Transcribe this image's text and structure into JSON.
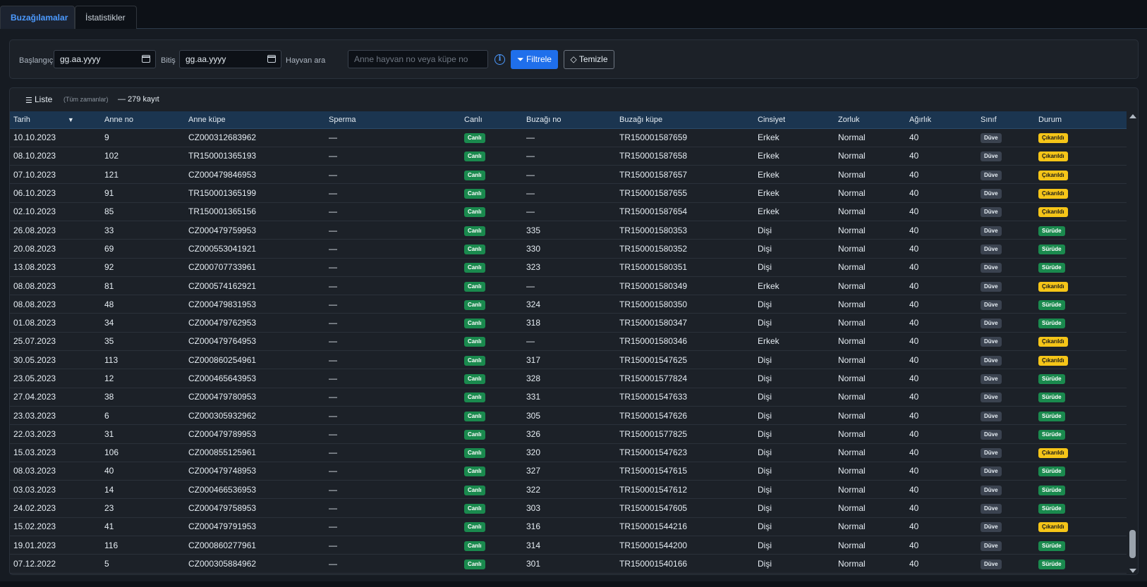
{
  "tabs": [
    {
      "label": "Buzağılamalar",
      "active": true
    },
    {
      "label": "İstatistikler",
      "active": false
    }
  ],
  "filter": {
    "start_label": "Başlangıç",
    "start_value": "gg.aa.yyyy",
    "end_label": "Bitiş",
    "end_value": "gg.aa.yyyy",
    "search_label": "Hayvan ara",
    "search_placeholder": "Anne hayvan no veya küpe no",
    "info_icon": "i",
    "filter_button": "Filtrele",
    "clear_button": "Temizle"
  },
  "list": {
    "icon": "☰",
    "title": "Liste",
    "period": "(Tüm zamanlar)",
    "count": "— 279 kayıt"
  },
  "columns": [
    "Tarih",
    "Anne no",
    "Anne küpe",
    "Sperma",
    "Canlı",
    "Buzağı no",
    "Buzağı küpe",
    "Cinsiyet",
    "Zorluk",
    "Ağırlık",
    "Sınıf",
    "Durum"
  ],
  "sort_indicator": "▼",
  "rows": [
    {
      "tarih": "10.10.2023",
      "anne_no": "9",
      "anne_kupe": "CZ000312683962",
      "sperma": "—",
      "canli": "Canlı",
      "buzagi_no": "—",
      "buzagi_kupe": "TR150001587659",
      "cinsiyet": "Erkek",
      "zorluk": "Normal",
      "agirlik": "40",
      "sinif": "Düve",
      "durum": "Çıkarıldı"
    },
    {
      "tarih": "08.10.2023",
      "anne_no": "102",
      "anne_kupe": "TR150001365193",
      "sperma": "—",
      "canli": "Canlı",
      "buzagi_no": "—",
      "buzagi_kupe": "TR150001587658",
      "cinsiyet": "Erkek",
      "zorluk": "Normal",
      "agirlik": "40",
      "sinif": "Düve",
      "durum": "Çıkarıldı"
    },
    {
      "tarih": "07.10.2023",
      "anne_no": "121",
      "anne_kupe": "CZ000479846953",
      "sperma": "—",
      "canli": "Canlı",
      "buzagi_no": "—",
      "buzagi_kupe": "TR150001587657",
      "cinsiyet": "Erkek",
      "zorluk": "Normal",
      "agirlik": "40",
      "sinif": "Düve",
      "durum": "Çıkarıldı"
    },
    {
      "tarih": "06.10.2023",
      "anne_no": "91",
      "anne_kupe": "TR150001365199",
      "sperma": "—",
      "canli": "Canlı",
      "buzagi_no": "—",
      "buzagi_kupe": "TR150001587655",
      "cinsiyet": "Erkek",
      "zorluk": "Normal",
      "agirlik": "40",
      "sinif": "Düve",
      "durum": "Çıkarıldı"
    },
    {
      "tarih": "02.10.2023",
      "anne_no": "85",
      "anne_kupe": "TR150001365156",
      "sperma": "—",
      "canli": "Canlı",
      "buzagi_no": "—",
      "buzagi_kupe": "TR150001587654",
      "cinsiyet": "Erkek",
      "zorluk": "Normal",
      "agirlik": "40",
      "sinif": "Düve",
      "durum": "Çıkarıldı"
    },
    {
      "tarih": "26.08.2023",
      "anne_no": "33",
      "anne_kupe": "CZ000479759953",
      "sperma": "—",
      "canli": "Canlı",
      "buzagi_no": "335",
      "buzagi_kupe": "TR150001580353",
      "cinsiyet": "Dişi",
      "zorluk": "Normal",
      "agirlik": "40",
      "sinif": "Düve",
      "durum": "Sürüde"
    },
    {
      "tarih": "20.08.2023",
      "anne_no": "69",
      "anne_kupe": "CZ000553041921",
      "sperma": "—",
      "canli": "Canlı",
      "buzagi_no": "330",
      "buzagi_kupe": "TR150001580352",
      "cinsiyet": "Dişi",
      "zorluk": "Normal",
      "agirlik": "40",
      "sinif": "Düve",
      "durum": "Sürüde"
    },
    {
      "tarih": "13.08.2023",
      "anne_no": "92",
      "anne_kupe": "CZ000707733961",
      "sperma": "—",
      "canli": "Canlı",
      "buzagi_no": "323",
      "buzagi_kupe": "TR150001580351",
      "cinsiyet": "Dişi",
      "zorluk": "Normal",
      "agirlik": "40",
      "sinif": "Düve",
      "durum": "Sürüde"
    },
    {
      "tarih": "08.08.2023",
      "anne_no": "81",
      "anne_kupe": "CZ000574162921",
      "sperma": "—",
      "canli": "Canlı",
      "buzagi_no": "—",
      "buzagi_kupe": "TR150001580349",
      "cinsiyet": "Erkek",
      "zorluk": "Normal",
      "agirlik": "40",
      "sinif": "Düve",
      "durum": "Çıkarıldı"
    },
    {
      "tarih": "08.08.2023",
      "anne_no": "48",
      "anne_kupe": "CZ000479831953",
      "sperma": "—",
      "canli": "Canlı",
      "buzagi_no": "324",
      "buzagi_kupe": "TR150001580350",
      "cinsiyet": "Dişi",
      "zorluk": "Normal",
      "agirlik": "40",
      "sinif": "Düve",
      "durum": "Sürüde"
    },
    {
      "tarih": "01.08.2023",
      "anne_no": "34",
      "anne_kupe": "CZ000479762953",
      "sperma": "—",
      "canli": "Canlı",
      "buzagi_no": "318",
      "buzagi_kupe": "TR150001580347",
      "cinsiyet": "Dişi",
      "zorluk": "Normal",
      "agirlik": "40",
      "sinif": "Düve",
      "durum": "Sürüde"
    },
    {
      "tarih": "25.07.2023",
      "anne_no": "35",
      "anne_kupe": "CZ000479764953",
      "sperma": "—",
      "canli": "Canlı",
      "buzagi_no": "—",
      "buzagi_kupe": "TR150001580346",
      "cinsiyet": "Erkek",
      "zorluk": "Normal",
      "agirlik": "40",
      "sinif": "Düve",
      "durum": "Çıkarıldı"
    },
    {
      "tarih": "30.05.2023",
      "anne_no": "113",
      "anne_kupe": "CZ000860254961",
      "sperma": "—",
      "canli": "Canlı",
      "buzagi_no": "317",
      "buzagi_kupe": "TR150001547625",
      "cinsiyet": "Dişi",
      "zorluk": "Normal",
      "agirlik": "40",
      "sinif": "Düve",
      "durum": "Çıkarıldı"
    },
    {
      "tarih": "23.05.2023",
      "anne_no": "12",
      "anne_kupe": "CZ000465643953",
      "sperma": "—",
      "canli": "Canlı",
      "buzagi_no": "328",
      "buzagi_kupe": "TR150001577824",
      "cinsiyet": "Dişi",
      "zorluk": "Normal",
      "agirlik": "40",
      "sinif": "Düve",
      "durum": "Sürüde"
    },
    {
      "tarih": "27.04.2023",
      "anne_no": "38",
      "anne_kupe": "CZ000479780953",
      "sperma": "—",
      "canli": "Canlı",
      "buzagi_no": "331",
      "buzagi_kupe": "TR150001547633",
      "cinsiyet": "Dişi",
      "zorluk": "Normal",
      "agirlik": "40",
      "sinif": "Düve",
      "durum": "Sürüde"
    },
    {
      "tarih": "23.03.2023",
      "anne_no": "6",
      "anne_kupe": "CZ000305932962",
      "sperma": "—",
      "canli": "Canlı",
      "buzagi_no": "305",
      "buzagi_kupe": "TR150001547626",
      "cinsiyet": "Dişi",
      "zorluk": "Normal",
      "agirlik": "40",
      "sinif": "Düve",
      "durum": "Sürüde"
    },
    {
      "tarih": "22.03.2023",
      "anne_no": "31",
      "anne_kupe": "CZ000479789953",
      "sperma": "—",
      "canli": "Canlı",
      "buzagi_no": "326",
      "buzagi_kupe": "TR150001577825",
      "cinsiyet": "Dişi",
      "zorluk": "Normal",
      "agirlik": "40",
      "sinif": "Düve",
      "durum": "Sürüde"
    },
    {
      "tarih": "15.03.2023",
      "anne_no": "106",
      "anne_kupe": "CZ000855125961",
      "sperma": "—",
      "canli": "Canlı",
      "buzagi_no": "320",
      "buzagi_kupe": "TR150001547623",
      "cinsiyet": "Dişi",
      "zorluk": "Normal",
      "agirlik": "40",
      "sinif": "Düve",
      "durum": "Çıkarıldı"
    },
    {
      "tarih": "08.03.2023",
      "anne_no": "40",
      "anne_kupe": "CZ000479748953",
      "sperma": "—",
      "canli": "Canlı",
      "buzagi_no": "327",
      "buzagi_kupe": "TR150001547615",
      "cinsiyet": "Dişi",
      "zorluk": "Normal",
      "agirlik": "40",
      "sinif": "Düve",
      "durum": "Sürüde"
    },
    {
      "tarih": "03.03.2023",
      "anne_no": "14",
      "anne_kupe": "CZ000466536953",
      "sperma": "—",
      "canli": "Canlı",
      "buzagi_no": "322",
      "buzagi_kupe": "TR150001547612",
      "cinsiyet": "Dişi",
      "zorluk": "Normal",
      "agirlik": "40",
      "sinif": "Düve",
      "durum": "Sürüde"
    },
    {
      "tarih": "24.02.2023",
      "anne_no": "23",
      "anne_kupe": "CZ000479758953",
      "sperma": "—",
      "canli": "Canlı",
      "buzagi_no": "303",
      "buzagi_kupe": "TR150001547605",
      "cinsiyet": "Dişi",
      "zorluk": "Normal",
      "agirlik": "40",
      "sinif": "Düve",
      "durum": "Sürüde"
    },
    {
      "tarih": "15.02.2023",
      "anne_no": "41",
      "anne_kupe": "CZ000479791953",
      "sperma": "—",
      "canli": "Canlı",
      "buzagi_no": "316",
      "buzagi_kupe": "TR150001544216",
      "cinsiyet": "Dişi",
      "zorluk": "Normal",
      "agirlik": "40",
      "sinif": "Düve",
      "durum": "Çıkarıldı"
    },
    {
      "tarih": "19.01.2023",
      "anne_no": "116",
      "anne_kupe": "CZ000860277961",
      "sperma": "—",
      "canli": "Canlı",
      "buzagi_no": "314",
      "buzagi_kupe": "TR150001544200",
      "cinsiyet": "Dişi",
      "zorluk": "Normal",
      "agirlik": "40",
      "sinif": "Düve",
      "durum": "Sürüde"
    },
    {
      "tarih": "07.12.2022",
      "anne_no": "5",
      "anne_kupe": "CZ000305884962",
      "sperma": "—",
      "canli": "Canlı",
      "buzagi_no": "301",
      "buzagi_kupe": "TR150001540166",
      "cinsiyet": "Dişi",
      "zorluk": "Normal",
      "agirlik": "40",
      "sinif": "Düve",
      "durum": "Sürüde"
    }
  ],
  "colors": {
    "accent": "#1f6feb",
    "tab_active": "#4c9aff",
    "badge_green": "#1a8a4e",
    "badge_yellow": "#f5c518",
    "badge_gray": "#3b4350",
    "header_bg": "#1b3550"
  }
}
